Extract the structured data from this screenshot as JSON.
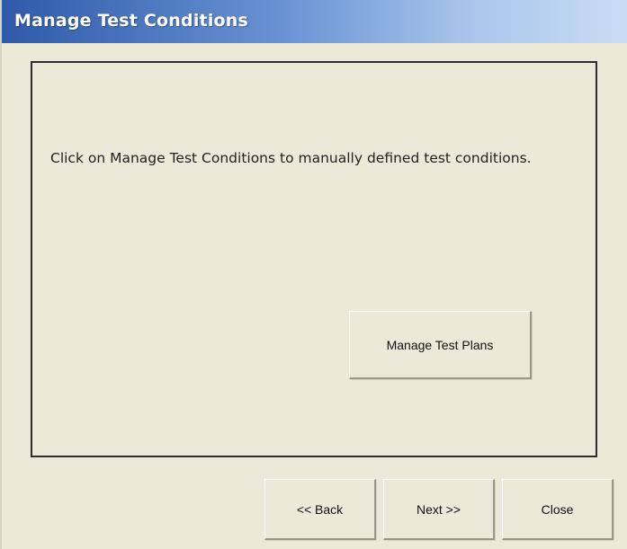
{
  "window": {
    "title": "Manage Test Conditions"
  },
  "panel": {
    "instruction": "Click on Manage Test Conditions to manually defined test conditions.",
    "manage_button_label": "Manage Test Plans"
  },
  "footer": {
    "back_label": "<< Back",
    "next_label": "Next >>",
    "close_label": "Close"
  },
  "colors": {
    "title_bar_start": "#2f5aa8",
    "title_bar_end": "#c9dcf4",
    "window_background": "#ece9d8",
    "panel_border": "#2e2e2e"
  }
}
